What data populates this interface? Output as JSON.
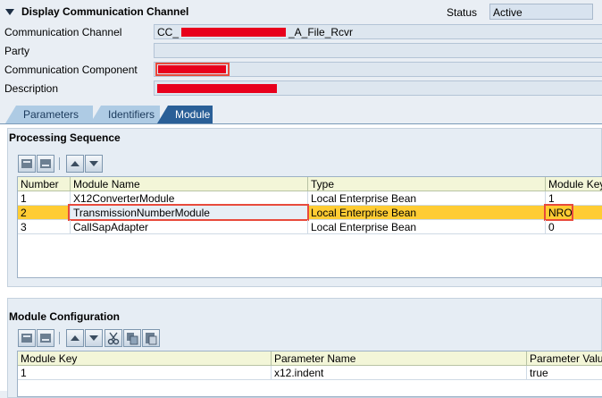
{
  "header": {
    "title": "Display Communication Channel",
    "status_label": "Status",
    "status_value": "Active"
  },
  "fields": {
    "channel": {
      "label": "Communication Channel",
      "prefix": "CC_",
      "suffix": "_A_File_Rcvr"
    },
    "party": {
      "label": "Party",
      "value": ""
    },
    "component": {
      "label": "Communication Component",
      "value": ""
    },
    "description": {
      "label": "Description",
      "value": ""
    }
  },
  "tabs": [
    {
      "label": "Parameters",
      "active": false
    },
    {
      "label": "Identifiers",
      "active": false
    },
    {
      "label": "Module",
      "active": true
    }
  ],
  "processing": {
    "title": "Processing Sequence",
    "columns": [
      "Number",
      "Module Name",
      "Type",
      "Module Key"
    ],
    "rows": [
      {
        "number": "1",
        "name": "X12ConverterModule",
        "type": "Local Enterprise Bean",
        "key": "1",
        "selected": false
      },
      {
        "number": "2",
        "name": "TransmissionNumberModule",
        "type": "Local Enterprise Bean",
        "key": "NRO",
        "selected": true
      },
      {
        "number": "3",
        "name": "CallSapAdapter",
        "type": "Local Enterprise Bean",
        "key": "0",
        "selected": false
      }
    ]
  },
  "configuration": {
    "title": "Module Configuration",
    "columns": [
      "Module Key",
      "Parameter Name",
      "Parameter Value"
    ],
    "rows": [
      {
        "key": "1",
        "param": "x12.indent",
        "value": "true"
      }
    ]
  },
  "colors": {
    "selected_row": "#ffcc33",
    "active_tab": "#2a5f97",
    "redaction": "#e8001c"
  }
}
